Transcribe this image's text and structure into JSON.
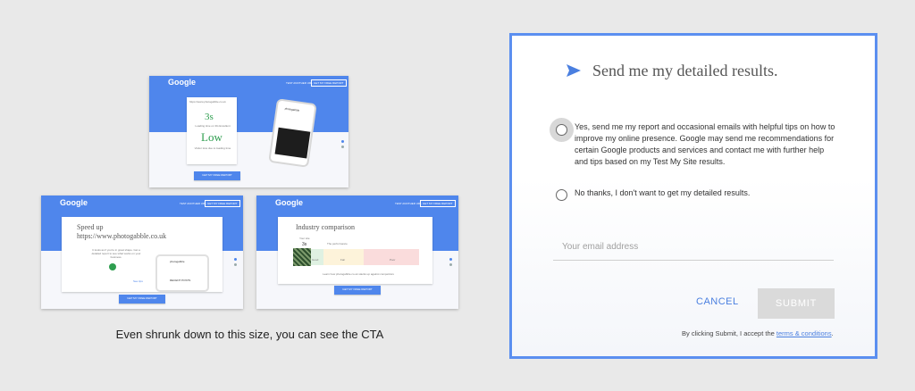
{
  "thumbs": {
    "common": {
      "logo": "Google",
      "header_link": "TEST ANOTHER URL",
      "header_button": "GET MY FREE REPORT",
      "cta": "GET MY FREE REPORT"
    },
    "top": {
      "url": "https://www.photogabble.co.uk",
      "time_value": "3s",
      "time_caption": "Loading time on 3G Excellent",
      "rating": "Low",
      "rating_caption": "Visitor loss due to loading time",
      "phone_title": "photogabble"
    },
    "left": {
      "title": "Speed up https://www.photogabble.co.uk",
      "body": "It looks as if you're in great shape. Get a detailed report to see what works on your business.",
      "link_text": "See tips",
      "phone_title": "photogabble",
      "phone_section": "RECENT POSTS"
    },
    "right": {
      "title": "Industry comparison",
      "your_site": "Your site",
      "value": "3s",
      "the_perform": "The performance",
      "labels": [
        "Good",
        "Fair",
        "Poor"
      ],
      "note": "Learn how photogabble.co.uk stacks up against competitors"
    }
  },
  "caption": "Even shrunk down to this size, you can see the CTA",
  "dialog": {
    "title": "Send me my detailed results.",
    "option_yes": "Yes, send me my report and occasional emails with helpful tips on how to improve my online presence. Google may send me recommendations for certain Google products and services and contact me with further help and tips based on my Test My Site results.",
    "option_no": "No thanks, I don't want to get my detailed results.",
    "email_placeholder": "Your email address",
    "cancel": "CANCEL",
    "submit": "SUBMIT",
    "terms_prefix": "By clicking Submit, I accept the ",
    "terms_link": "terms & conditions",
    "terms_suffix": ".",
    "accent": "#5b8ff0"
  }
}
